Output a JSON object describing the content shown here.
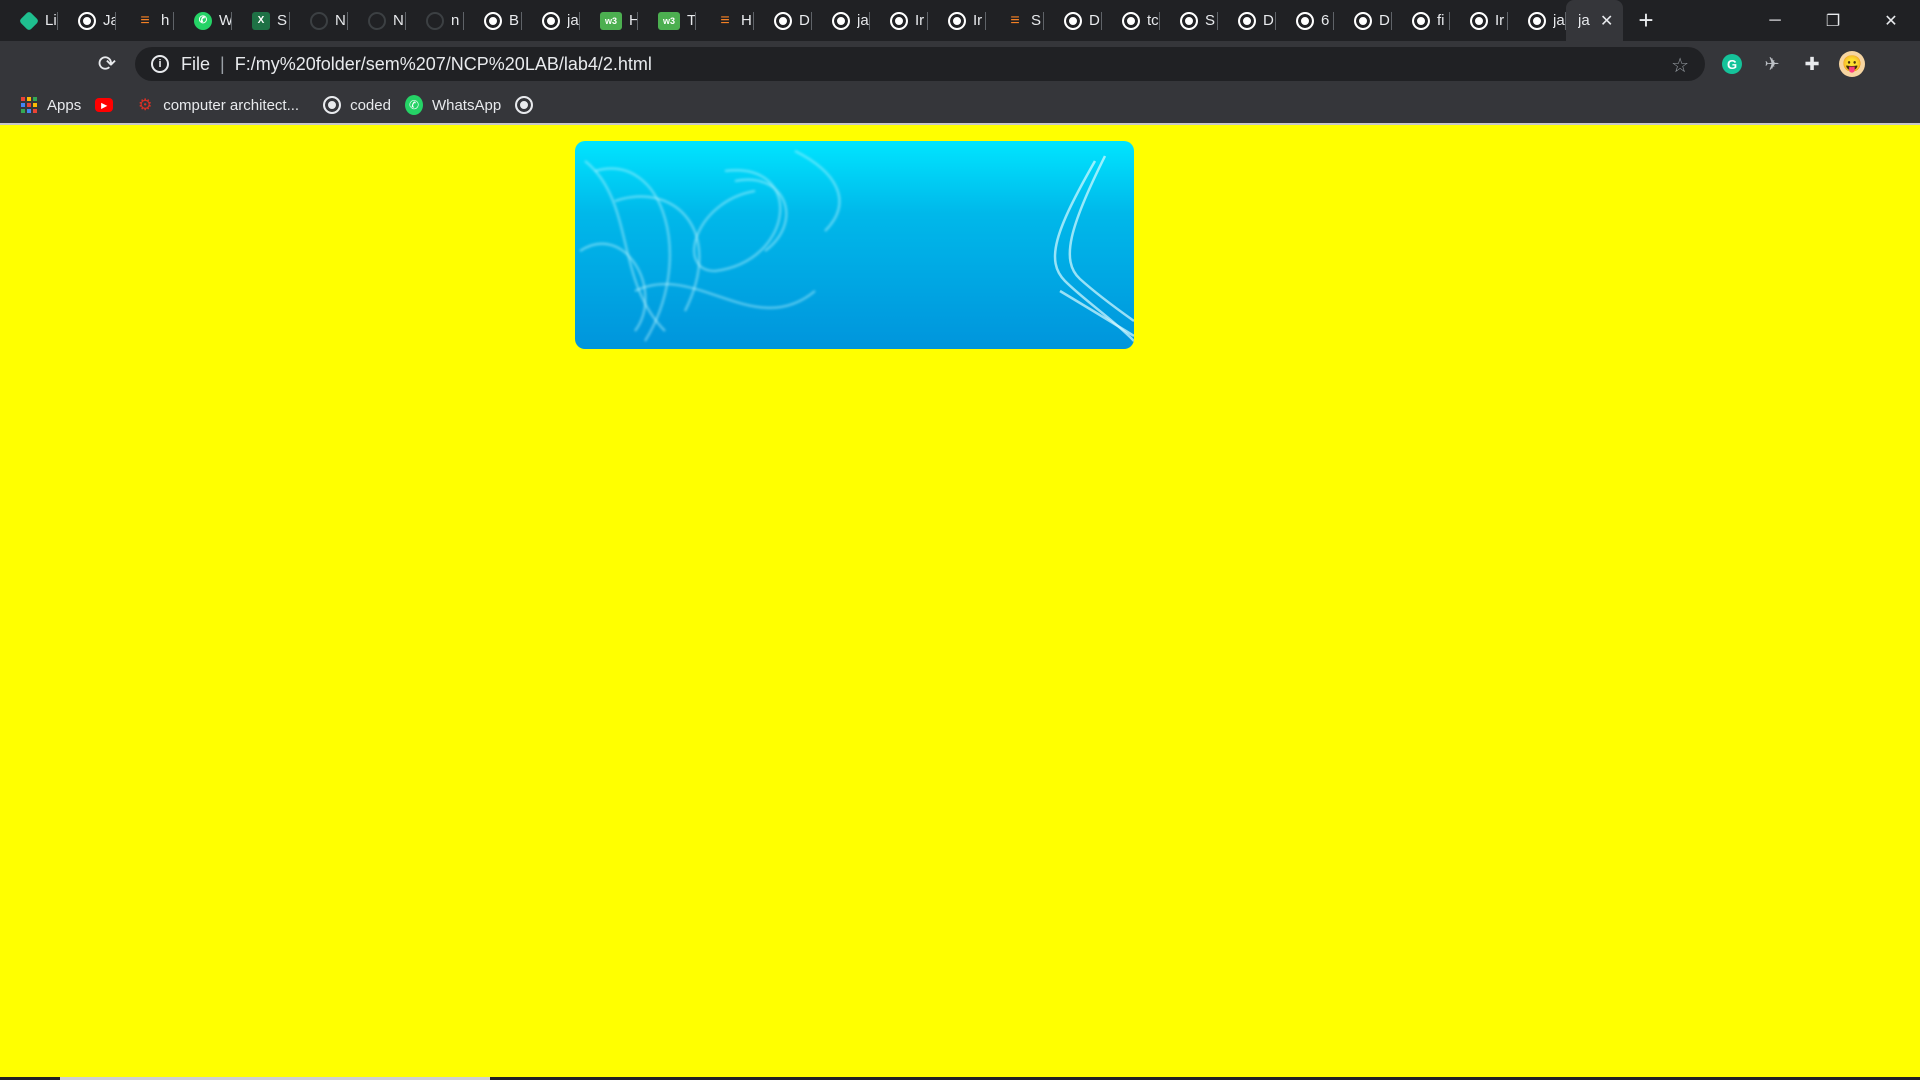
{
  "browser": {
    "tabs": [
      {
        "favicon": "hex-icon",
        "title": "Li"
      },
      {
        "favicon": "globe-icon",
        "title": "Ja"
      },
      {
        "favicon": "stackoverflow-icon",
        "title": "h"
      },
      {
        "favicon": "whatsapp-icon",
        "title": "W"
      },
      {
        "favicon": "excel-icon",
        "title": "S"
      },
      {
        "favicon": "github-icon",
        "title": "N"
      },
      {
        "favicon": "github-icon",
        "title": "N"
      },
      {
        "favicon": "github-icon",
        "title": "n"
      },
      {
        "favicon": "globe-icon",
        "title": "B"
      },
      {
        "favicon": "globe-icon",
        "title": "ja"
      },
      {
        "favicon": "w3schools-icon",
        "title": "H"
      },
      {
        "favicon": "w3schools-icon",
        "title": "Ti"
      },
      {
        "favicon": "stackoverflow-icon",
        "title": "H"
      },
      {
        "favicon": "globe-icon",
        "title": "D"
      },
      {
        "favicon": "globe-icon",
        "title": "ja"
      },
      {
        "favicon": "globe-icon",
        "title": "Ir"
      },
      {
        "favicon": "globe-icon",
        "title": "Ir"
      },
      {
        "favicon": "stackoverflow-icon",
        "title": "S"
      },
      {
        "favicon": "globe-icon",
        "title": "D"
      },
      {
        "favicon": "globe-icon",
        "title": "tc"
      },
      {
        "favicon": "globe-icon",
        "title": "S"
      },
      {
        "favicon": "globe-icon",
        "title": "D"
      },
      {
        "favicon": "globe-icon",
        "title": "6"
      },
      {
        "favicon": "globe-icon",
        "title": "D"
      },
      {
        "favicon": "globe-icon",
        "title": "fi"
      },
      {
        "favicon": "globe-icon",
        "title": "Ir"
      },
      {
        "favicon": "globe-icon",
        "title": "ja"
      }
    ],
    "active_tab": {
      "title": "ja",
      "close": "✕"
    },
    "new_tab": "+",
    "window_controls": {
      "minimize": "─",
      "restore": "❐",
      "close": "✕"
    },
    "toolbar": {
      "reload": "⟳",
      "site_info": "i",
      "scheme_label": "File",
      "separator": "|",
      "url": "F:/my%20folder/sem%207/NCP%20LAB/lab4/2.html",
      "bookmark_star": "☆",
      "grammarly": "G",
      "extension": "✈",
      "extensions_puzzle": "✚",
      "profile": "😛"
    },
    "bookmarks": [
      {
        "icon": "apps-grid-icon",
        "label": "Apps"
      },
      {
        "icon": "youtube-icon",
        "label": ""
      },
      {
        "icon": "computer-architecture-icon",
        "label": "computer architect..."
      },
      {
        "icon": "globe-icon",
        "label": "coded"
      },
      {
        "icon": "whatsapp-icon",
        "label": "WhatsApp"
      },
      {
        "icon": "globe-icon",
        "label": ""
      }
    ]
  },
  "page": {
    "background": "#ffff00",
    "banner": {
      "type": "abstract blue swirl image",
      "colors": [
        "#00e5ff",
        "#0095dc"
      ]
    }
  }
}
